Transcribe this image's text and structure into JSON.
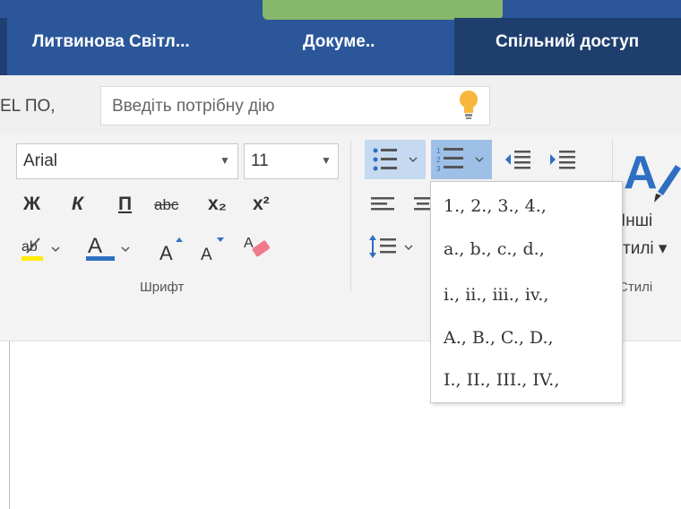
{
  "titlebar": {
    "user_name": "Литвинова Світл...",
    "document_name": "Докуме..",
    "share_label": "Спільний доступ"
  },
  "tellme": {
    "tab_fragment": "EL ПО,",
    "placeholder": "Введіть потрібну дію"
  },
  "font_group": {
    "font_name": "Arial",
    "font_size": "11",
    "buttons": {
      "bold": "Ж",
      "italic": "К",
      "underline": "П",
      "strikethrough": "abc",
      "subscript": "x₂",
      "superscript": "x²"
    },
    "label": "Шрифт"
  },
  "paragraph_group": {
    "icons": [
      "bullets-icon",
      "numbering-icon",
      "decrease-indent-icon",
      "increase-indent-icon",
      "align-left-icon",
      "align-center-icon",
      "line-spacing-icon"
    ]
  },
  "styles_group": {
    "label_line1": "Інші",
    "label_line2": "тилі ▾",
    "group_label": "Стилі"
  },
  "numbering_menu": {
    "items": [
      "1., 2., 3., 4.,",
      "a., b., c., d.,",
      "i., ii., iii., iv.,",
      "A., B., C., D.,",
      "I., II., III., IV.,"
    ]
  },
  "colors": {
    "title_bar": "#2b579a",
    "share_area": "#1e3f6e",
    "accent_green": "#86b76a",
    "highlight_yellow": "#ffeb00",
    "font_color_blue": "#2e6fc2",
    "selected_button": "#9fc0e6"
  }
}
